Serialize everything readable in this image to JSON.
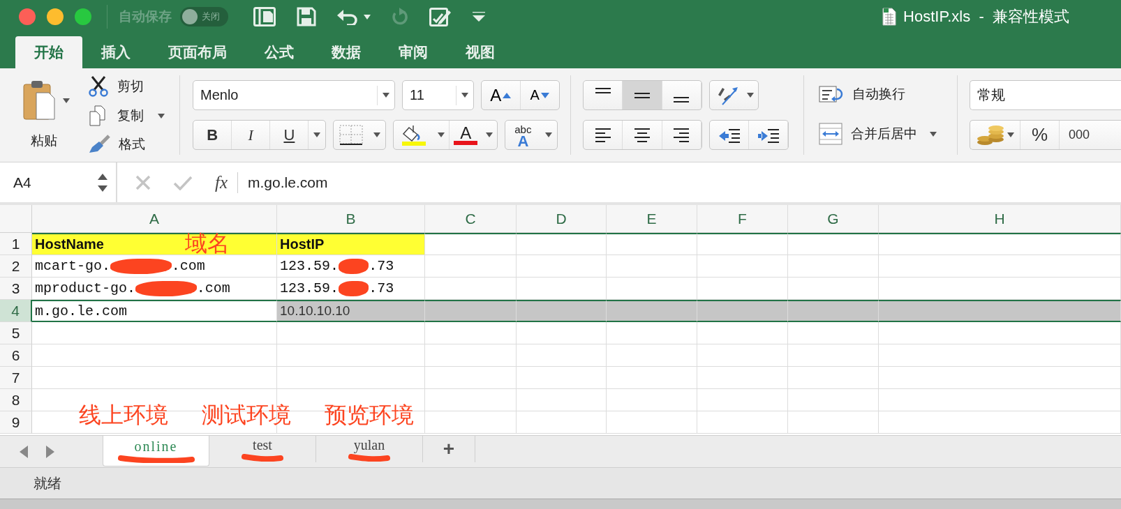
{
  "title_bar": {
    "autosave_label": "自动保存",
    "autosave_toggle": {
      "label": "关闭",
      "on": false
    },
    "document_title": "HostIP.xls  -  兼容性模式"
  },
  "ribbon_tabs": [
    {
      "label": "开始",
      "selected": true
    },
    {
      "label": "插入",
      "selected": false
    },
    {
      "label": "页面布局",
      "selected": false
    },
    {
      "label": "公式",
      "selected": false
    },
    {
      "label": "数据",
      "selected": false
    },
    {
      "label": "审阅",
      "selected": false
    },
    {
      "label": "视图",
      "selected": false
    }
  ],
  "ribbon": {
    "paste": {
      "label": "粘贴"
    },
    "clipboard": [
      {
        "label": "剪切",
        "kind": "cut"
      },
      {
        "label": "复制",
        "kind": "copy"
      },
      {
        "label": "格式",
        "kind": "format"
      }
    ],
    "font": {
      "name": "Menlo",
      "size": "11",
      "grow": "A",
      "shrink": "A",
      "bold": "B",
      "italic": "I",
      "underline": "U",
      "font_color": "A",
      "text_effect_top": "abc",
      "text_effect_bottom": "A"
    },
    "vertical_alignment": [
      {
        "kind": "top",
        "selected": false
      },
      {
        "kind": "middle",
        "selected": true
      },
      {
        "kind": "bottom",
        "selected": false
      }
    ],
    "wrap_text": "自动换行",
    "merge_center": "合并后居中",
    "number": {
      "format": "常规",
      "percent": "%",
      "thousands": "000"
    }
  },
  "formula_bar": {
    "name_box": "A4",
    "function_label": "fx",
    "formula": "m.go.le.com"
  },
  "sheet": {
    "columns": [
      "A",
      "B",
      "C",
      "D",
      "E",
      "F",
      "G",
      "H"
    ],
    "rows": [
      {
        "header": "1",
        "selected": false,
        "cells": [
          {
            "parts": [
              "HostName"
            ],
            "kind": "header"
          },
          {
            "parts": [
              "HostIP"
            ],
            "kind": "header"
          }
        ]
      },
      {
        "header": "2",
        "selected": false,
        "cells": [
          {
            "parts": [
              "mcart-go.",
              ".com"
            ],
            "kind": "mono",
            "redacted": true
          },
          {
            "parts": [
              "123.59.",
              ".73"
            ],
            "kind": "mono",
            "redacted": true
          }
        ]
      },
      {
        "header": "3",
        "selected": false,
        "cells": [
          {
            "parts": [
              "mproduct-go.",
              ".com"
            ],
            "kind": "mono",
            "redacted": true
          },
          {
            "parts": [
              "123.59.",
              ".73"
            ],
            "kind": "mono",
            "redacted": true
          }
        ]
      },
      {
        "header": "4",
        "selected": true,
        "cells": [
          {
            "parts": [
              "m.go.le.com"
            ],
            "kind": "mono"
          },
          {
            "parts": [
              "10.10.10.10"
            ],
            "kind": "sans"
          }
        ]
      },
      {
        "header": "5",
        "selected": false,
        "cells": []
      },
      {
        "header": "6",
        "selected": false,
        "cells": []
      },
      {
        "header": "7",
        "selected": false,
        "cells": []
      },
      {
        "header": "8",
        "selected": false,
        "cells": []
      },
      {
        "header": "9",
        "selected": false,
        "cells": []
      }
    ],
    "header_annotation": "域名",
    "tab_annotations": [
      "线上环境",
      "测试环境",
      "预览环境"
    ]
  },
  "sheet_tabs": [
    {
      "label": "online",
      "selected": true,
      "underlined": true
    },
    {
      "label": "test",
      "selected": false,
      "underlined": true
    },
    {
      "label": "yulan",
      "selected": false,
      "underlined": true
    }
  ],
  "add_sheet": "+",
  "status_bar": "就绪"
}
